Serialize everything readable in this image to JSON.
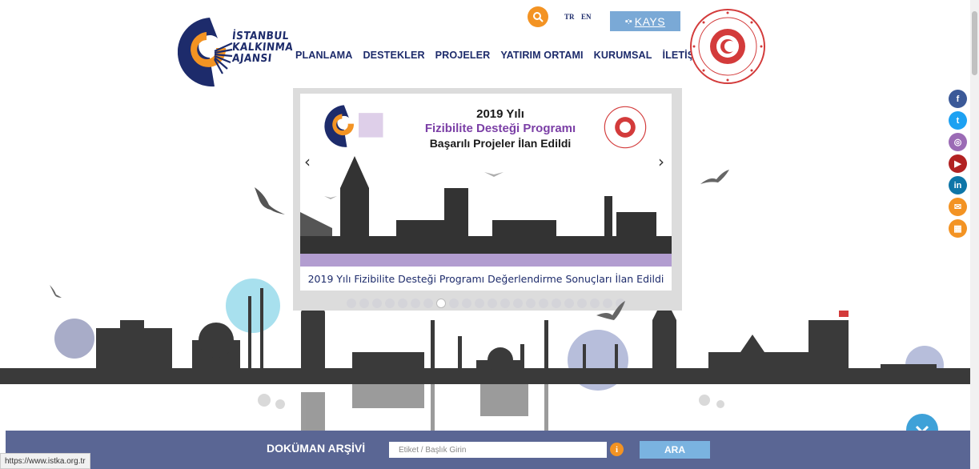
{
  "logo": {
    "lines": [
      "İSTANBUL",
      "KALKINMA",
      "AJANSI"
    ]
  },
  "nav": [
    "PLANLAMA",
    "DESTEKLER",
    "PROJELER",
    "YATIRIM ORTAMI",
    "KURUMSAL",
    "İLETİŞİM"
  ],
  "lang": {
    "tr": "TR",
    "en": "EN"
  },
  "kays": {
    "label": "KAYS"
  },
  "slider": {
    "title_line1": "2019 Yılı",
    "title_line2": "Fizibilite Desteği Programı",
    "title_line3": "Başarılı Projeler İlan Edildi",
    "caption": "2019 Yılı Fizibilite Desteği Programı Değerlendirme Sonuçları İlan Edildi",
    "dot_count": 22,
    "active_dot": 7
  },
  "social": [
    {
      "name": "facebook",
      "glyph": "f",
      "color": "#3b5998"
    },
    {
      "name": "twitter",
      "glyph": "t",
      "color": "#1da1f2"
    },
    {
      "name": "instagram",
      "glyph": "◎",
      "color": "#9b6bb5"
    },
    {
      "name": "youtube",
      "glyph": "▶",
      "color": "#b22222"
    },
    {
      "name": "linkedin",
      "glyph": "in",
      "color": "#0e76a8"
    },
    {
      "name": "email",
      "glyph": "✉",
      "color": "#f39323"
    },
    {
      "name": "apps",
      "glyph": "▦",
      "color": "#f39323"
    }
  ],
  "archive": {
    "title": "DOKÜMAN ARŞİVİ",
    "placeholder": "Etiket / Başlık Girin",
    "button": "ARA",
    "info": "i"
  },
  "status_url": "https://www.istka.org.tr"
}
